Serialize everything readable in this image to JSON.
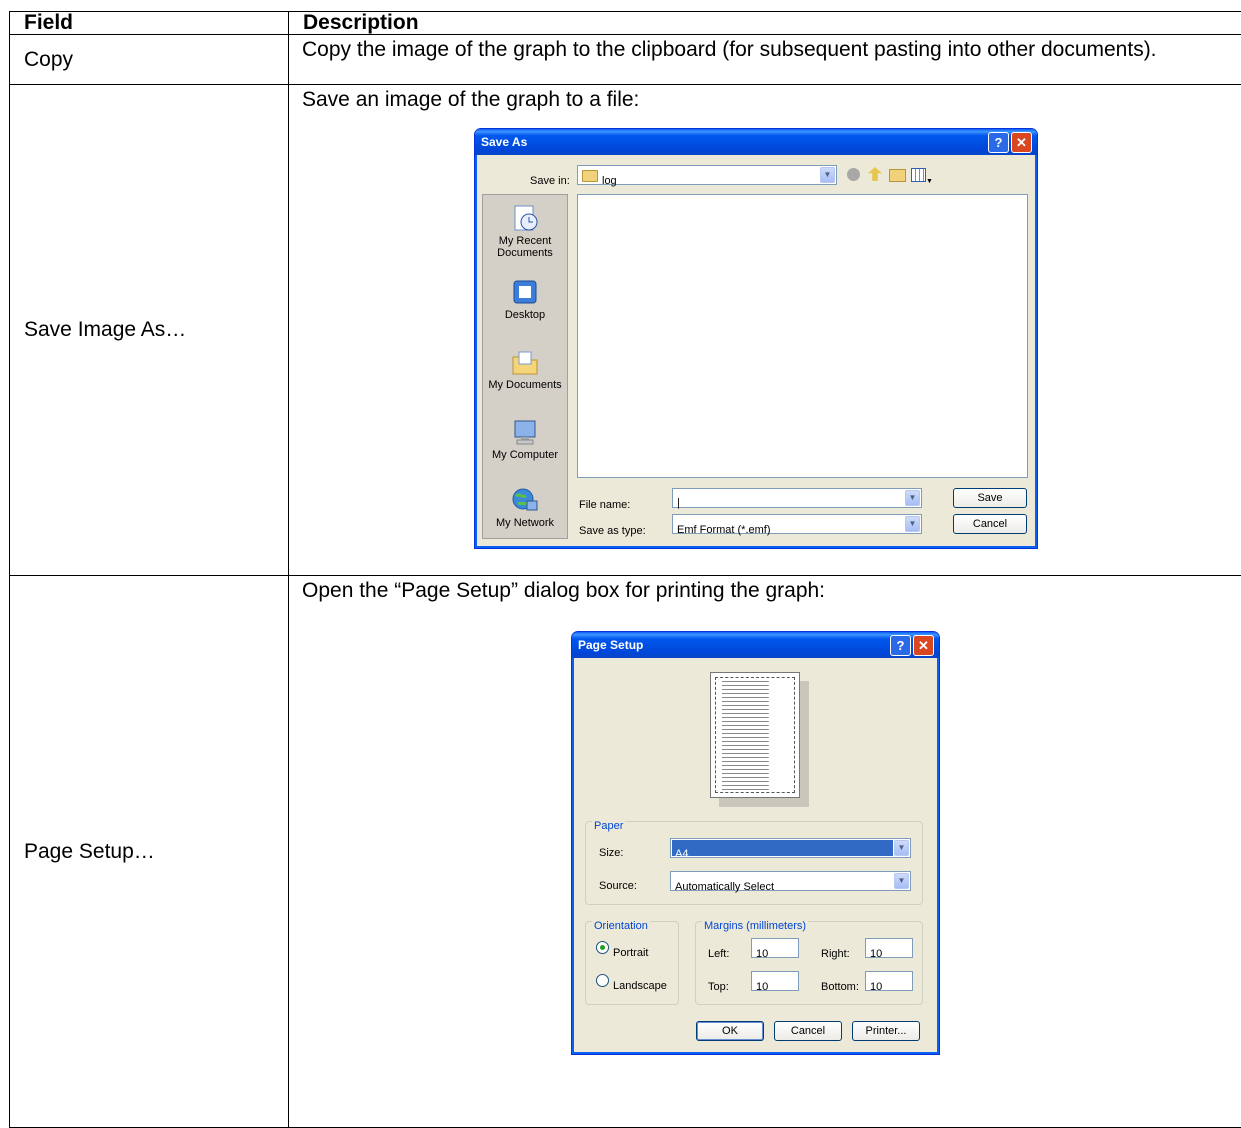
{
  "table": {
    "header": {
      "field": "Field",
      "description": "Description"
    },
    "rows": [
      {
        "field": "Copy",
        "description": "Copy the image of the graph to the clipboard (for subsequent pasting into other documents)."
      },
      {
        "field": "Save Image As…",
        "description": "Save an image of the graph to a file:"
      },
      {
        "field": "Page Setup…",
        "description": "Open the “Page Setup” dialog box for printing the graph:"
      }
    ]
  },
  "save_dialog": {
    "title": "Save As",
    "help_glyph": "?",
    "close_glyph": "✕",
    "save_in_label": "Save in:",
    "save_in_value": "log",
    "places": [
      "My Recent Documents",
      "Desktop",
      "My Documents",
      "My Computer",
      "My Network"
    ],
    "file_name_label": "File name:",
    "file_name_value": "|",
    "save_as_type_label": "Save as type:",
    "save_as_type_value": "Emf Format (*.emf)",
    "save_button": "Save",
    "cancel_button": "Cancel"
  },
  "page_setup": {
    "title": "Page Setup",
    "help_glyph": "?",
    "close_glyph": "✕",
    "paper_legend": "Paper",
    "size_label": "Size:",
    "size_value": "A4",
    "source_label": "Source:",
    "source_value": "Automatically Select",
    "orientation_legend": "Orientation",
    "portrait_label": "Portrait",
    "landscape_label": "Landscape",
    "selected_orientation": "Portrait",
    "margins_legend": "Margins (millimeters)",
    "left_label": "Left:",
    "left_value": "10",
    "right_label": "Right:",
    "right_value": "10",
    "top_label": "Top:",
    "top_value": "10",
    "bottom_label": "Bottom:",
    "bottom_value": "10",
    "ok_button": "OK",
    "cancel_button": "Cancel",
    "printer_button": "Printer..."
  },
  "colors": {
    "title_blue": "#0058ee",
    "close_red": "#d9461f",
    "dialog_face": "#ece9d8",
    "selection_blue": "#316ac5",
    "group_legend": "#0046d5"
  }
}
